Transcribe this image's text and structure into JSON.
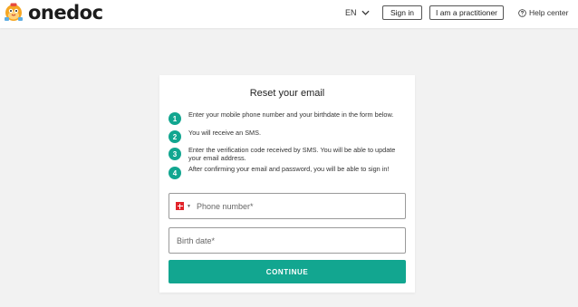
{
  "header": {
    "logo_text": "onedoc",
    "language": "EN",
    "sign_in_label": "Sign in",
    "practitioner_label": "I am a practitioner",
    "help_label": "Help center"
  },
  "card": {
    "title": "Reset your email",
    "steps": [
      {
        "number": "1",
        "text": "Enter your mobile phone number and your birthdate in the form below."
      },
      {
        "number": "2",
        "text": "You will receive an SMS."
      },
      {
        "number": "3",
        "text": "Enter the verification code received by SMS. You will be able to update your email address."
      },
      {
        "number": "4",
        "text": "After confirming your email and password, you will be able to sign in!"
      }
    ],
    "phone": {
      "placeholder": "Phone number*",
      "country_icon": "swiss-flag-icon"
    },
    "birth": {
      "placeholder": "Birth date*"
    },
    "continue_label": "CONTINUE"
  },
  "colors": {
    "accent": "#12a690",
    "background": "#f2f2f2",
    "logo_mascot": "#f5a623"
  }
}
